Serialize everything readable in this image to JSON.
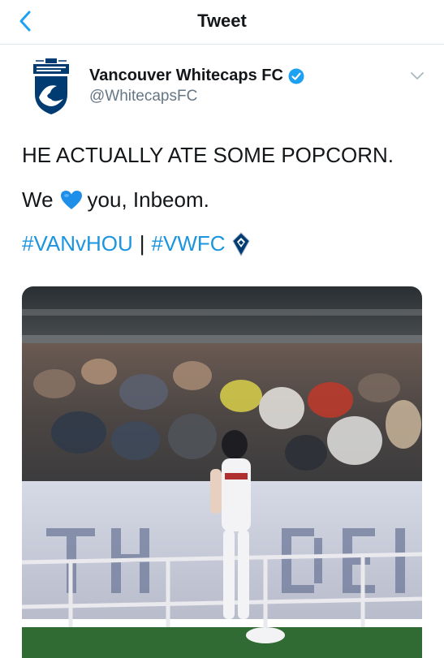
{
  "header": {
    "title": "Tweet"
  },
  "account": {
    "name": "Vancouver Whitecaps FC",
    "handle": "@WhitecapsFC"
  },
  "tweet": {
    "line1": "HE ACTUALLY ATE SOME POPCORN.",
    "line2_before": "We",
    "line2_after": "you, Inbeom.",
    "hashtag1": "#VANvHOU",
    "separator": "|",
    "hashtag2": "#VWFC"
  },
  "colors": {
    "link": "#1b95e0",
    "heart": "#1d8fe8",
    "verified": "#1da1f2",
    "crest": "#003b71"
  }
}
